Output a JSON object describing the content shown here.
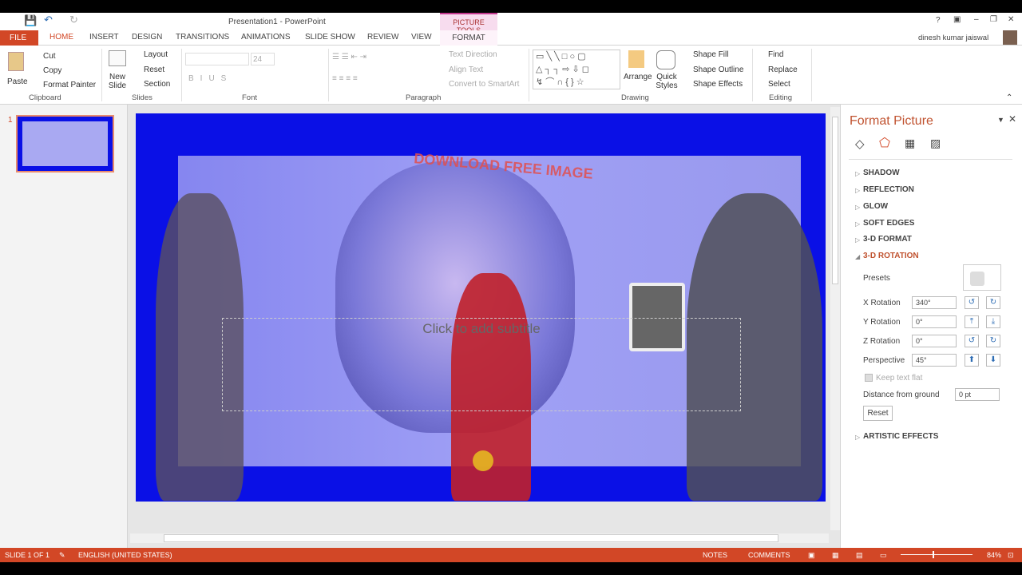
{
  "title": "Presentation1 - PowerPoint",
  "context_tab_group": "PICTURE TOOLS",
  "user": "dinesh kumar jaiswal",
  "window_controls": [
    "?",
    "restore-ribbon",
    "minimize",
    "restore",
    "close"
  ],
  "tabs": [
    "FILE",
    "HOME",
    "INSERT",
    "DESIGN",
    "TRANSITIONS",
    "ANIMATIONS",
    "SLIDE SHOW",
    "REVIEW",
    "VIEW",
    "FORMAT"
  ],
  "ribbon": {
    "clipboard": {
      "label": "Clipboard",
      "paste": "Paste",
      "cut": "Cut",
      "copy": "Copy",
      "format_painter": "Format Painter"
    },
    "slides": {
      "label": "Slides",
      "new_slide": "New Slide",
      "layout": "Layout",
      "reset": "Reset",
      "section": "Section"
    },
    "font": {
      "label": "Font",
      "size": "24"
    },
    "paragraph": {
      "label": "Paragraph",
      "text_direction": "Text Direction",
      "align_text": "Align Text",
      "convert": "Convert to SmartArt"
    },
    "drawing": {
      "label": "Drawing",
      "arrange": "Arrange",
      "quick_styles": "Quick Styles",
      "shape_fill": "Shape Fill",
      "shape_outline": "Shape Outline",
      "shape_effects": "Shape Effects"
    },
    "editing": {
      "label": "Editing",
      "find": "Find",
      "replace": "Replace",
      "select": "Select"
    }
  },
  "thumbnail": {
    "number": "1"
  },
  "slide": {
    "watermark": "DOWNLOAD FREE IMAGE",
    "subtitle_placeholder": "Click to add subtitle"
  },
  "pane": {
    "title": "Format Picture",
    "sections": [
      "SHADOW",
      "REFLECTION",
      "GLOW",
      "SOFT EDGES",
      "3-D FORMAT"
    ],
    "active_section": "3-D ROTATION",
    "presets": "Presets",
    "x_rotation": {
      "label": "X Rotation",
      "value": "340°"
    },
    "y_rotation": {
      "label": "Y Rotation",
      "value": "0°"
    },
    "z_rotation": {
      "label": "Z Rotation",
      "value": "0°"
    },
    "perspective": {
      "label": "Perspective",
      "value": "45°"
    },
    "keep_text_flat": "Keep text flat",
    "distance": {
      "label": "Distance from ground",
      "value": "0 pt"
    },
    "reset": "Reset",
    "artistic": "ARTISTIC EFFECTS"
  },
  "status": {
    "slide": "SLIDE 1 OF 1",
    "language": "ENGLISH (UNITED STATES)",
    "notes": "NOTES",
    "comments": "COMMENTS",
    "zoom": "84%"
  },
  "colors": {
    "accent": "#d24726",
    "slide_bg": "#0a10e6",
    "context_tab": "#f3c6e2"
  }
}
